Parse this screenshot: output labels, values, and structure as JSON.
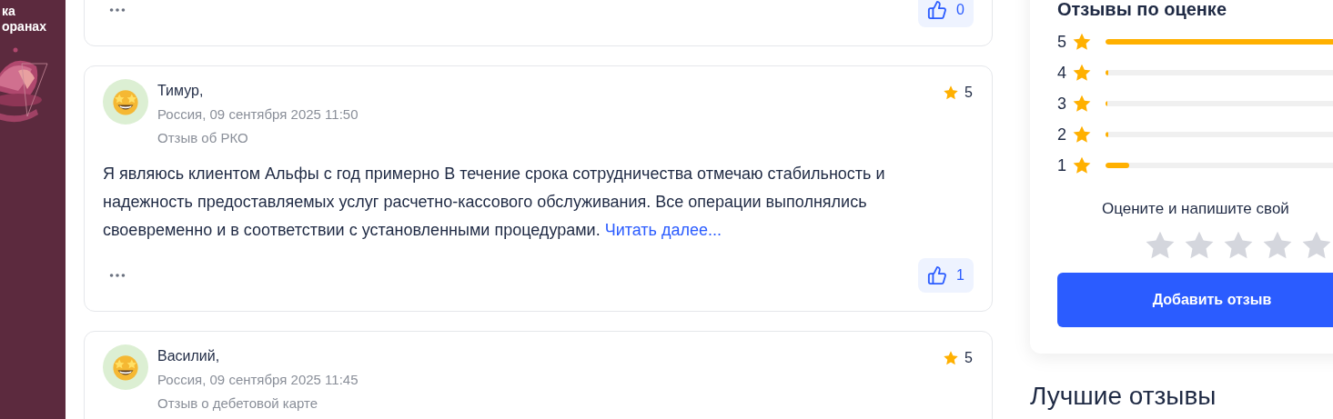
{
  "banner": {
    "lines": [
      "ка",
      "оранах"
    ]
  },
  "reviews": [
    {
      "kind": "partial",
      "likes": "0"
    },
    {
      "kind": "full",
      "name": "Тимур,",
      "meta": "Россия, 09 сентября 2025 11:50",
      "topic": "Отзыв об РКО",
      "rating": "5",
      "text": "Я являюсь клиентом Альфы с год примерно В течение срока сотрудничества отмечаю стабильность и надежность предоставляемых услуг расчетно-кассового обслуживания. Все операции выполнялись своевременно и в соответствии с установленными процедурами.",
      "more": "Читать далее...",
      "likes": "1"
    },
    {
      "kind": "full",
      "name": "Василий,",
      "meta": "Россия, 09 сентября 2025 11:45",
      "topic": "Отзыв о дебетовой карте",
      "rating": "5"
    }
  ],
  "rating_breakdown": {
    "title": "Отзывы по оценке",
    "rows": [
      {
        "label": "5",
        "level": 0.96
      },
      {
        "label": "4",
        "level": 0.012
      },
      {
        "label": "3",
        "level": 0.006
      },
      {
        "label": "2",
        "level": 0.01
      },
      {
        "label": "1",
        "level": 0.09
      }
    ]
  },
  "rate_prompt": "Оцените и напишите свой",
  "rate_stars": {
    "stars": 0
  },
  "add_button": "Добавить отзыв",
  "best_title": "Лучшие отзывы"
}
